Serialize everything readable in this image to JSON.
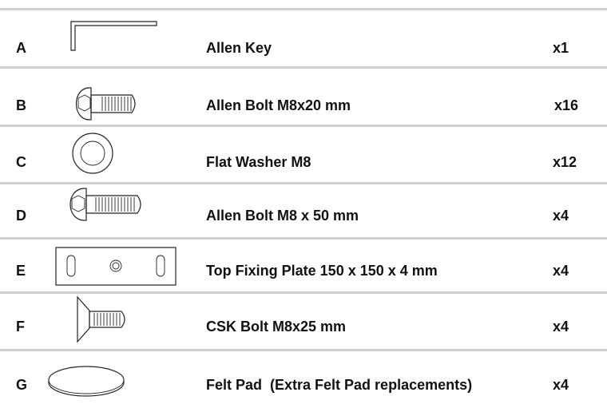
{
  "parts": [
    {
      "letter": "A",
      "icon": "allen-key-icon",
      "name": "Allen Key",
      "qty": "x1"
    },
    {
      "letter": "B",
      "icon": "allen-bolt-short-icon",
      "name": "Allen Bolt M8x20 mm",
      "qty": "x16"
    },
    {
      "letter": "C",
      "icon": "flat-washer-icon",
      "name": "Flat Washer M8",
      "qty": "x12"
    },
    {
      "letter": "D",
      "icon": "allen-bolt-long-icon",
      "name": "Allen Bolt M8 x 50 mm",
      "qty": "x4"
    },
    {
      "letter": "E",
      "icon": "fixing-plate-icon",
      "name": "Top Fixing Plate 150 x 150 x 4 mm",
      "qty": "x4"
    },
    {
      "letter": "F",
      "icon": "csk-bolt-icon",
      "name": "CSK Bolt M8x25 mm",
      "qty": "x4"
    },
    {
      "letter": "G",
      "icon": "felt-pad-icon",
      "name": "Felt Pad  (Extra Felt Pad replacements)",
      "qty": "x4"
    }
  ]
}
